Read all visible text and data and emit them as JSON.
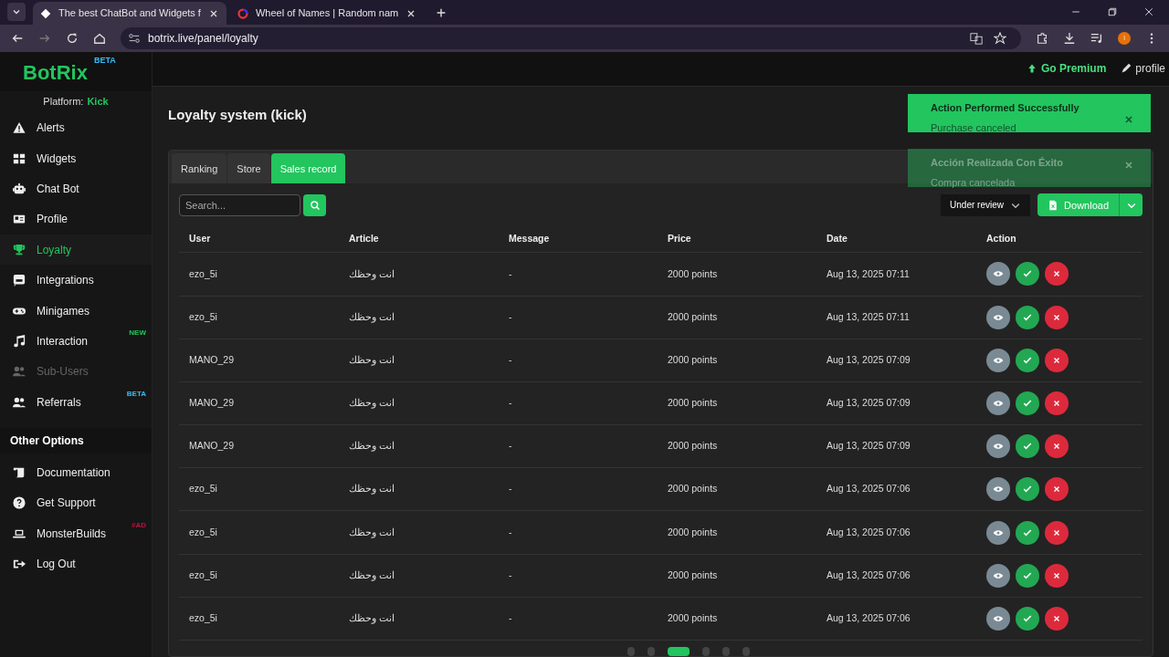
{
  "browser": {
    "tabs": [
      {
        "title": "The best ChatBot and Widgets f",
        "selected": true
      },
      {
        "title": "Wheel of Names | Random nam",
        "selected": false
      }
    ],
    "url": "botrix.live/panel/loyalty",
    "profile_initial": "I"
  },
  "brand": {
    "logo": "BotRix",
    "badge": "BETA",
    "platform_label": "Platform:",
    "platform": "Kick"
  },
  "sidebar": {
    "items": [
      {
        "label": "Alerts",
        "selected": false,
        "disabled": false
      },
      {
        "label": "Widgets",
        "selected": false,
        "disabled": false
      },
      {
        "label": "Chat Bot",
        "selected": false,
        "disabled": false
      },
      {
        "label": "Profile",
        "selected": false,
        "disabled": false
      },
      {
        "label": "Loyalty",
        "selected": true,
        "disabled": false
      },
      {
        "label": "Integrations",
        "selected": false,
        "disabled": false
      },
      {
        "label": "Minigames",
        "selected": false,
        "disabled": false
      },
      {
        "label": "Interaction",
        "selected": false,
        "disabled": false,
        "badge": "NEW",
        "color": "#22c55e"
      },
      {
        "label": "Sub-Users",
        "selected": false,
        "disabled": true
      },
      {
        "label": "Referrals",
        "selected": false,
        "disabled": false,
        "badge": "BETA",
        "color": "#38bdf8"
      }
    ],
    "section_title": "Other Options",
    "other_items": [
      {
        "label": "Documentation"
      },
      {
        "label": "Get Support"
      },
      {
        "label": "MonsterBuilds",
        "badge": "#AD",
        "color": "#be123c"
      },
      {
        "label": "Log Out"
      }
    ]
  },
  "header": {
    "premium": "Go Premium",
    "profile": "profile"
  },
  "toasts": [
    {
      "title": "Action Performed Successfully",
      "message": "Purchase canceled",
      "faded": false
    },
    {
      "title": "Acción Realizada Con Éxito",
      "message": "Compra cancelada",
      "faded": true
    }
  ],
  "page_title": "Loyalty system (kick)",
  "tabs": [
    {
      "label": "Ranking",
      "selected": false
    },
    {
      "label": "Store",
      "selected": false
    },
    {
      "label": "Sales record",
      "selected": true
    }
  ],
  "search": {
    "placeholder": "Search..."
  },
  "filter": {
    "value": "Under review"
  },
  "download": {
    "label": "Download"
  },
  "table": {
    "columns": [
      "User",
      "Article",
      "Message",
      "Price",
      "Date",
      "Action"
    ],
    "rows": [
      [
        "ezo_5i",
        "انت وحظك",
        "-",
        "2000 points",
        "Aug 13, 2025 07:11"
      ],
      [
        "ezo_5i",
        "انت وحظك",
        "-",
        "2000 points",
        "Aug 13, 2025 07:11"
      ],
      [
        "MANO_29",
        "انت وحظك",
        "-",
        "2000 points",
        "Aug 13, 2025 07:09"
      ],
      [
        "MANO_29",
        "انت وحظك",
        "-",
        "2000 points",
        "Aug 13, 2025 07:09"
      ],
      [
        "MANO_29",
        "انت وحظك",
        "-",
        "2000 points",
        "Aug 13, 2025 07:09"
      ],
      [
        "ezo_5i",
        "انت وحظك",
        "-",
        "2000 points",
        "Aug 13, 2025 07:06"
      ],
      [
        "ezo_5i",
        "انت وحظك",
        "-",
        "2000 points",
        "Aug 13, 2025 07:06"
      ],
      [
        "ezo_5i",
        "انت وحظك",
        "-",
        "2000 points",
        "Aug 13, 2025 07:06"
      ],
      [
        "ezo_5i",
        "انت وحظك",
        "-",
        "2000 points",
        "Aug 13, 2025 07:06"
      ]
    ]
  },
  "pagination": {
    "pages": [
      {
        "selected": false
      },
      {
        "selected": false
      },
      {
        "selected": true
      },
      {
        "selected": false
      },
      {
        "selected": false
      },
      {
        "selected": false
      }
    ]
  }
}
